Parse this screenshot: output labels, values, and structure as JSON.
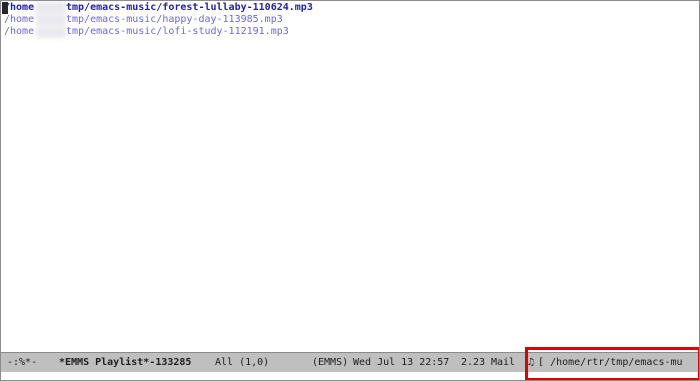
{
  "playlist": {
    "tracks": [
      {
        "prefix": "/home",
        "path": "tmp/emacs-music/forest-lullaby-110624.mp3",
        "current": true
      },
      {
        "prefix": "/home",
        "path": "tmp/emacs-music/happy-day-113985.mp3",
        "current": false
      },
      {
        "prefix": "/home",
        "path": "tmp/emacs-music/lofi-study-112191.mp3",
        "current": false
      }
    ]
  },
  "modeline": {
    "status": "-:%*-",
    "buffer_name": "*EMMS Playlist*-133285",
    "position": "All (1,0)",
    "mode": "(EMMS)",
    "datetime": "Wed Jul 13 22:57",
    "load": "2.23",
    "mail": "Mail",
    "now_playing": "[ /home/rtr/tmp/emacs-mu",
    "note_icon": "♫"
  },
  "colors": {
    "current_track": "#1f1fa8",
    "track": "#6a6ad2",
    "highlight": "#e00000",
    "modeline_bg": "#bfbfbf"
  }
}
